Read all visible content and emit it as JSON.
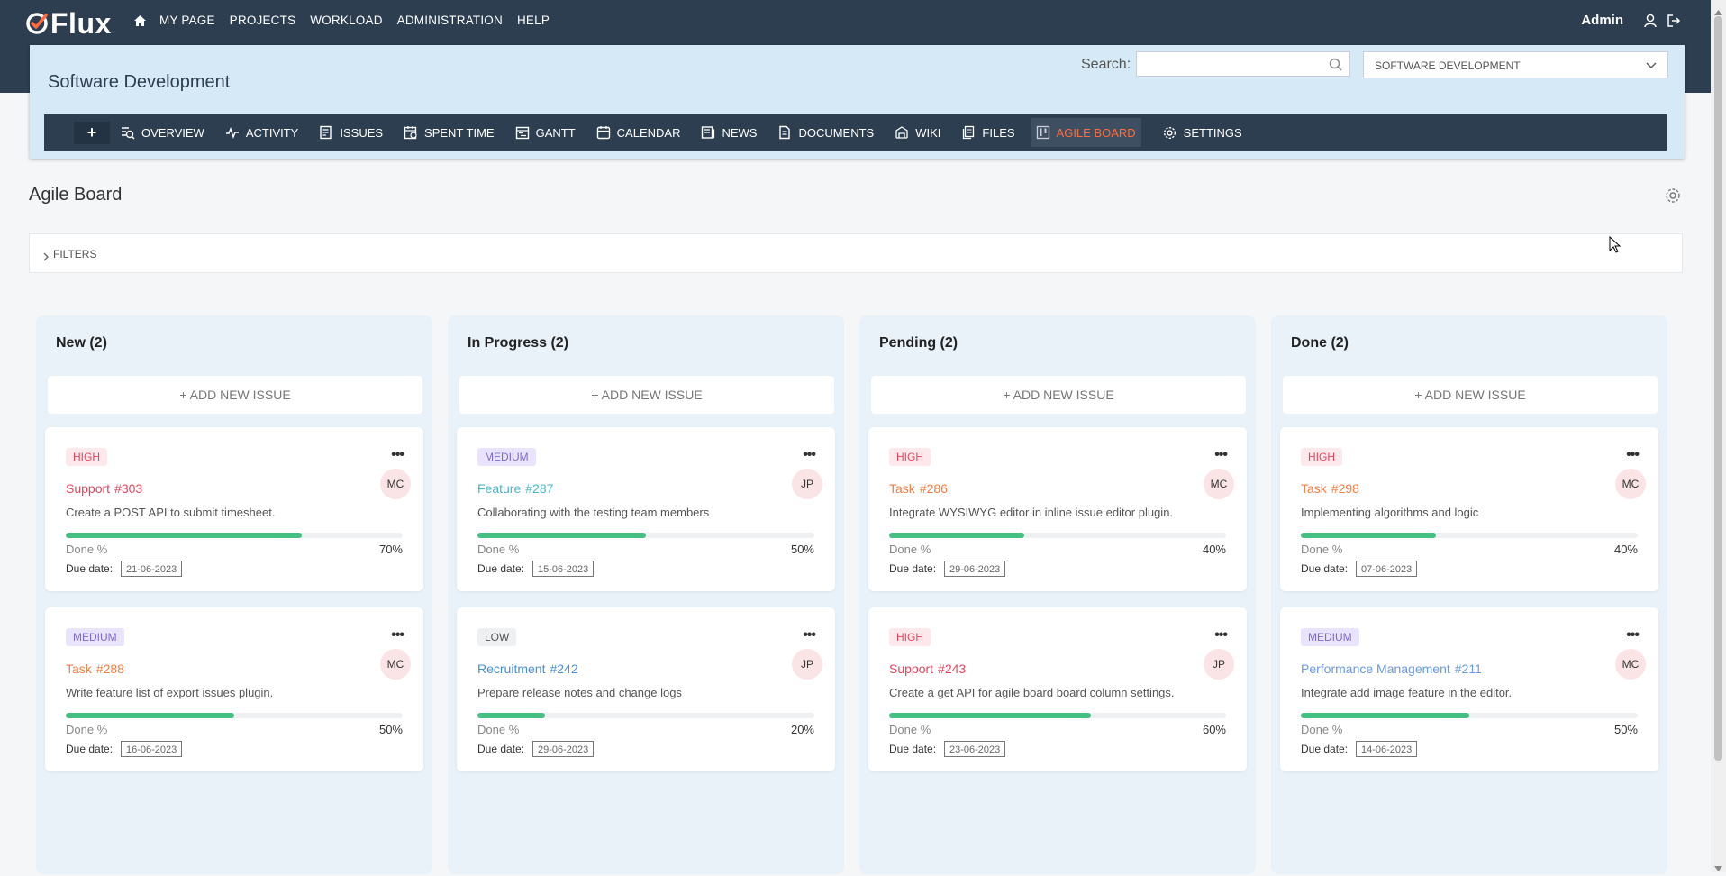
{
  "app": {
    "logo_text": "Flux"
  },
  "nav": {
    "items": [
      "MY PAGE",
      "PROJECTS",
      "WORKLOAD",
      "ADMINISTRATION",
      "HELP"
    ],
    "user": "Admin"
  },
  "project": {
    "title": "Software Development",
    "search_label": "Search:",
    "search_value": "",
    "selected_project": "SOFTWARE DEVELOPMENT",
    "add_label": "+",
    "tabs": [
      {
        "label": "OVERVIEW",
        "icon": "overview-icon"
      },
      {
        "label": "ACTIVITY",
        "icon": "activity-icon"
      },
      {
        "label": "ISSUES",
        "icon": "issues-icon"
      },
      {
        "label": "SPENT TIME",
        "icon": "spent-time-icon"
      },
      {
        "label": "GANTT",
        "icon": "gantt-icon"
      },
      {
        "label": "CALENDAR",
        "icon": "calendar-icon"
      },
      {
        "label": "NEWS",
        "icon": "news-icon"
      },
      {
        "label": "DOCUMENTS",
        "icon": "documents-icon"
      },
      {
        "label": "WIKI",
        "icon": "wiki-icon"
      },
      {
        "label": "FILES",
        "icon": "files-icon"
      },
      {
        "label": "AGILE BOARD",
        "icon": "agile-board-icon",
        "active": true
      },
      {
        "label": "SETTINGS",
        "icon": "settings-icon"
      }
    ],
    "active_tab_color": "#ff6b3d"
  },
  "board": {
    "title": "Agile Board",
    "filters_label": "FILTERS",
    "add_issue_label": "+ ADD NEW ISSUE",
    "done_label": "Done %",
    "due_label": "Due date:",
    "columns": [
      {
        "title": "New (2)",
        "cards": [
          {
            "priority": "HIGH",
            "tracker": "Support",
            "number": "#303",
            "subject": "Create a POST API to submit timesheet.",
            "assignee": "MC",
            "done": "70%",
            "done_fraction": 0.7,
            "due": "21-06-2023"
          },
          {
            "priority": "MEDIUM",
            "tracker": "Task",
            "number": "#288",
            "subject": "Write feature list of export issues plugin.",
            "assignee": "MC",
            "done": "50%",
            "done_fraction": 0.5,
            "due": "16-06-2023"
          }
        ]
      },
      {
        "title": "In Progress (2)",
        "cards": [
          {
            "priority": "MEDIUM",
            "tracker": "Feature",
            "number": "#287",
            "subject": "Collaborating with the testing team members",
            "assignee": "JP",
            "done": "50%",
            "done_fraction": 0.5,
            "due": "15-06-2023"
          },
          {
            "priority": "LOW",
            "tracker": "Recruitment",
            "number": "#242",
            "subject": "Prepare release notes and change logs",
            "assignee": "JP",
            "done": "20%",
            "done_fraction": 0.2,
            "due": "29-06-2023"
          }
        ]
      },
      {
        "title": "Pending (2)",
        "cards": [
          {
            "priority": "HIGH",
            "tracker": "Task",
            "number": "#286",
            "subject": "Integrate WYSIWYG editor in inline issue editor plugin.",
            "assignee": "MC",
            "done": "40%",
            "done_fraction": 0.4,
            "due": "29-06-2023"
          },
          {
            "priority": "HIGH",
            "tracker": "Support",
            "number": "#243",
            "subject": "Create a get API for agile board board column settings.",
            "assignee": "JP",
            "done": "60%",
            "done_fraction": 0.6,
            "due": "23-06-2023"
          }
        ]
      },
      {
        "title": "Done (2)",
        "cards": [
          {
            "priority": "HIGH",
            "tracker": "Task",
            "number": "#298",
            "subject": "Implementing algorithms and logic",
            "assignee": "MC",
            "done": "40%",
            "done_fraction": 0.4,
            "due": "07-06-2023"
          },
          {
            "priority": "MEDIUM",
            "tracker": "Performance Management",
            "number": "#211",
            "subject": "Integrate add image feature in the editor.",
            "assignee": "MC",
            "done": "50%",
            "done_fraction": 0.5,
            "due": "14-06-2023"
          }
        ]
      }
    ]
  },
  "colors": {
    "topbar": "#2d3e50",
    "project_panel": "#d6e9f7",
    "progress": "#45c083",
    "high": "#e0475d",
    "medium": "#7e6bd1"
  }
}
